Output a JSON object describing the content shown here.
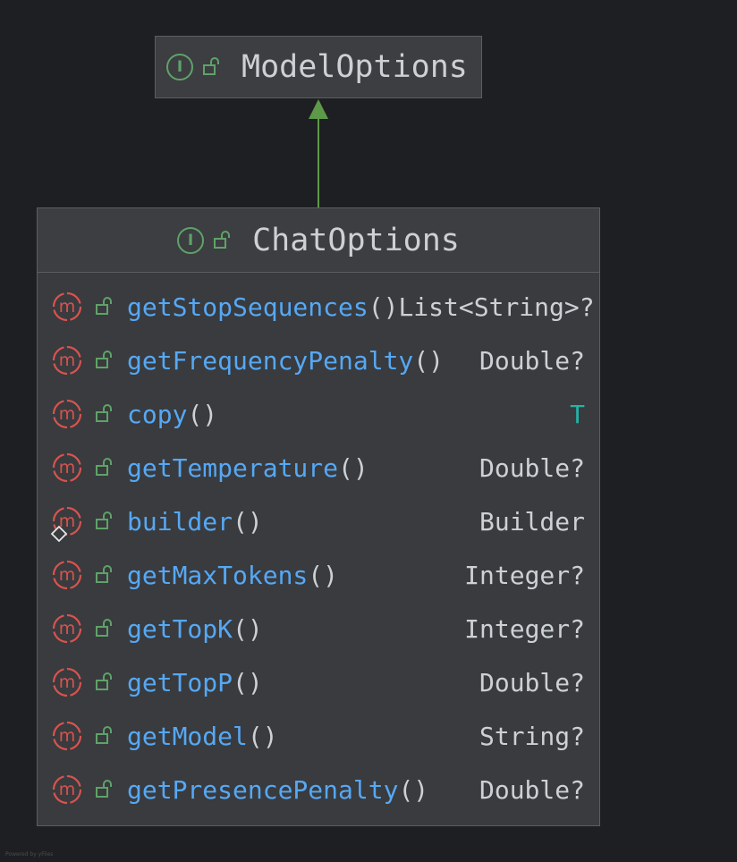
{
  "colors": {
    "background": "#1e1f22",
    "box_fill": "#3b3d40",
    "box_border": "#5b5d62",
    "interface_icon": "#5fa269",
    "method_icon": "#d9534f",
    "method_name": "#56a8f5",
    "text": "#cdd0d4",
    "generic_type": "#24b3a5",
    "arrow": "#5e9949"
  },
  "parent": {
    "name": "ModelOptions",
    "kind_icon": "interface-icon",
    "kind_letter": "I",
    "visibility_icon": "public-lock-icon"
  },
  "child": {
    "name": "ChatOptions",
    "kind_icon": "interface-icon",
    "kind_letter": "I",
    "visibility_icon": "public-lock-icon",
    "members": [
      {
        "name": "getStopSequences",
        "parens": "()",
        "type": "List<String>?",
        "static": false,
        "generic": false
      },
      {
        "name": "getFrequencyPenalty",
        "parens": "()",
        "type": "Double?",
        "static": false,
        "generic": false
      },
      {
        "name": "copy",
        "parens": "()",
        "type": "T",
        "static": false,
        "generic": true
      },
      {
        "name": "getTemperature",
        "parens": "()",
        "type": "Double?",
        "static": false,
        "generic": false
      },
      {
        "name": "builder",
        "parens": "()",
        "type": "Builder",
        "static": true,
        "generic": false
      },
      {
        "name": "getMaxTokens",
        "parens": "()",
        "type": "Integer?",
        "static": false,
        "generic": false
      },
      {
        "name": "getTopK",
        "parens": "()",
        "type": "Integer?",
        "static": false,
        "generic": false
      },
      {
        "name": "getTopP",
        "parens": "()",
        "type": "Double?",
        "static": false,
        "generic": false
      },
      {
        "name": "getModel",
        "parens": "()",
        "type": "String?",
        "static": false,
        "generic": false
      },
      {
        "name": "getPresencePenalty",
        "parens": "()",
        "type": "Double?",
        "static": false,
        "generic": false
      }
    ]
  },
  "relation": {
    "type": "extends",
    "from": "ChatOptions",
    "to": "ModelOptions"
  },
  "footer": "Powered by yFiles"
}
